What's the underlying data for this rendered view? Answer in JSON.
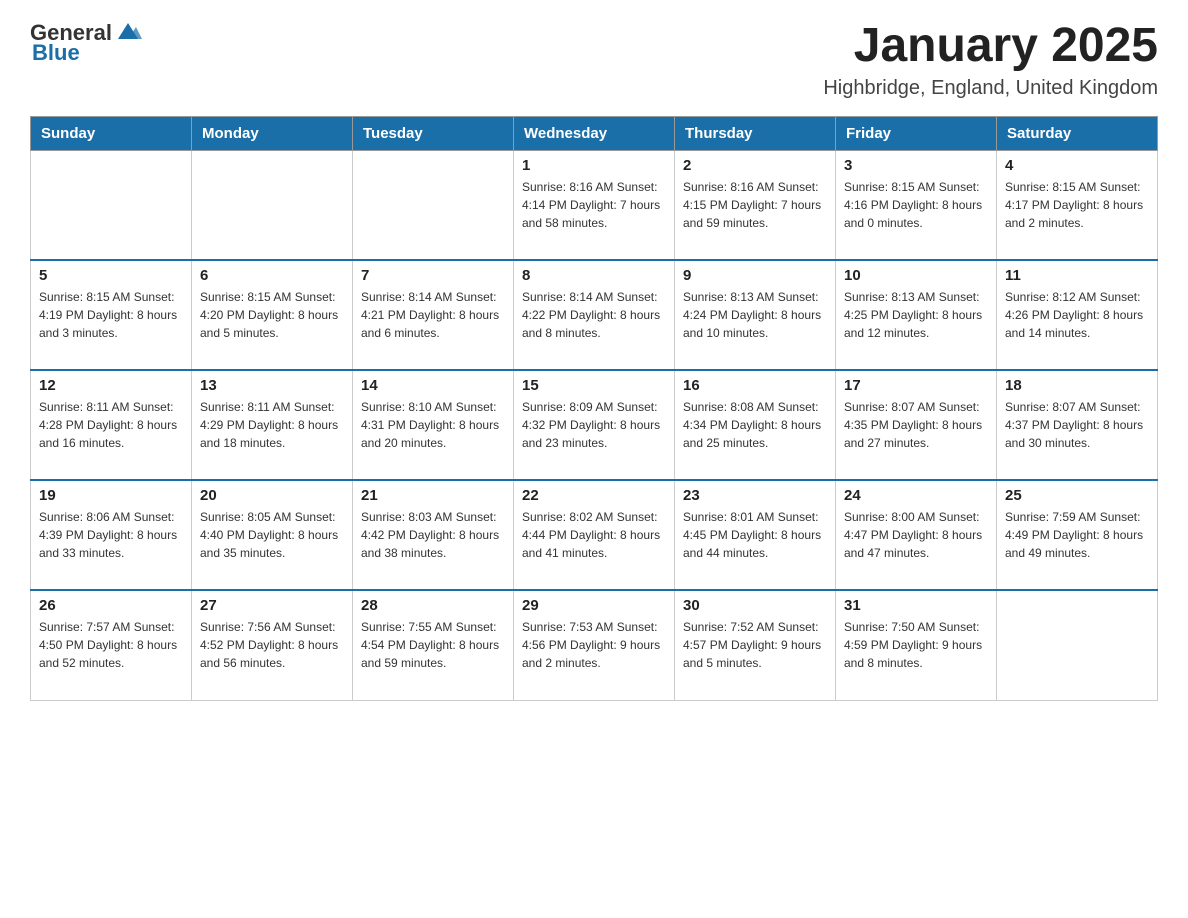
{
  "header": {
    "logo_general": "General",
    "logo_blue": "Blue",
    "month_title": "January 2025",
    "location": "Highbridge, England, United Kingdom"
  },
  "days_of_week": [
    "Sunday",
    "Monday",
    "Tuesday",
    "Wednesday",
    "Thursday",
    "Friday",
    "Saturday"
  ],
  "weeks": [
    [
      {
        "day": "",
        "info": ""
      },
      {
        "day": "",
        "info": ""
      },
      {
        "day": "",
        "info": ""
      },
      {
        "day": "1",
        "info": "Sunrise: 8:16 AM\nSunset: 4:14 PM\nDaylight: 7 hours\nand 58 minutes."
      },
      {
        "day": "2",
        "info": "Sunrise: 8:16 AM\nSunset: 4:15 PM\nDaylight: 7 hours\nand 59 minutes."
      },
      {
        "day": "3",
        "info": "Sunrise: 8:15 AM\nSunset: 4:16 PM\nDaylight: 8 hours\nand 0 minutes."
      },
      {
        "day": "4",
        "info": "Sunrise: 8:15 AM\nSunset: 4:17 PM\nDaylight: 8 hours\nand 2 minutes."
      }
    ],
    [
      {
        "day": "5",
        "info": "Sunrise: 8:15 AM\nSunset: 4:19 PM\nDaylight: 8 hours\nand 3 minutes."
      },
      {
        "day": "6",
        "info": "Sunrise: 8:15 AM\nSunset: 4:20 PM\nDaylight: 8 hours\nand 5 minutes."
      },
      {
        "day": "7",
        "info": "Sunrise: 8:14 AM\nSunset: 4:21 PM\nDaylight: 8 hours\nand 6 minutes."
      },
      {
        "day": "8",
        "info": "Sunrise: 8:14 AM\nSunset: 4:22 PM\nDaylight: 8 hours\nand 8 minutes."
      },
      {
        "day": "9",
        "info": "Sunrise: 8:13 AM\nSunset: 4:24 PM\nDaylight: 8 hours\nand 10 minutes."
      },
      {
        "day": "10",
        "info": "Sunrise: 8:13 AM\nSunset: 4:25 PM\nDaylight: 8 hours\nand 12 minutes."
      },
      {
        "day": "11",
        "info": "Sunrise: 8:12 AM\nSunset: 4:26 PM\nDaylight: 8 hours\nand 14 minutes."
      }
    ],
    [
      {
        "day": "12",
        "info": "Sunrise: 8:11 AM\nSunset: 4:28 PM\nDaylight: 8 hours\nand 16 minutes."
      },
      {
        "day": "13",
        "info": "Sunrise: 8:11 AM\nSunset: 4:29 PM\nDaylight: 8 hours\nand 18 minutes."
      },
      {
        "day": "14",
        "info": "Sunrise: 8:10 AM\nSunset: 4:31 PM\nDaylight: 8 hours\nand 20 minutes."
      },
      {
        "day": "15",
        "info": "Sunrise: 8:09 AM\nSunset: 4:32 PM\nDaylight: 8 hours\nand 23 minutes."
      },
      {
        "day": "16",
        "info": "Sunrise: 8:08 AM\nSunset: 4:34 PM\nDaylight: 8 hours\nand 25 minutes."
      },
      {
        "day": "17",
        "info": "Sunrise: 8:07 AM\nSunset: 4:35 PM\nDaylight: 8 hours\nand 27 minutes."
      },
      {
        "day": "18",
        "info": "Sunrise: 8:07 AM\nSunset: 4:37 PM\nDaylight: 8 hours\nand 30 minutes."
      }
    ],
    [
      {
        "day": "19",
        "info": "Sunrise: 8:06 AM\nSunset: 4:39 PM\nDaylight: 8 hours\nand 33 minutes."
      },
      {
        "day": "20",
        "info": "Sunrise: 8:05 AM\nSunset: 4:40 PM\nDaylight: 8 hours\nand 35 minutes."
      },
      {
        "day": "21",
        "info": "Sunrise: 8:03 AM\nSunset: 4:42 PM\nDaylight: 8 hours\nand 38 minutes."
      },
      {
        "day": "22",
        "info": "Sunrise: 8:02 AM\nSunset: 4:44 PM\nDaylight: 8 hours\nand 41 minutes."
      },
      {
        "day": "23",
        "info": "Sunrise: 8:01 AM\nSunset: 4:45 PM\nDaylight: 8 hours\nand 44 minutes."
      },
      {
        "day": "24",
        "info": "Sunrise: 8:00 AM\nSunset: 4:47 PM\nDaylight: 8 hours\nand 47 minutes."
      },
      {
        "day": "25",
        "info": "Sunrise: 7:59 AM\nSunset: 4:49 PM\nDaylight: 8 hours\nand 49 minutes."
      }
    ],
    [
      {
        "day": "26",
        "info": "Sunrise: 7:57 AM\nSunset: 4:50 PM\nDaylight: 8 hours\nand 52 minutes."
      },
      {
        "day": "27",
        "info": "Sunrise: 7:56 AM\nSunset: 4:52 PM\nDaylight: 8 hours\nand 56 minutes."
      },
      {
        "day": "28",
        "info": "Sunrise: 7:55 AM\nSunset: 4:54 PM\nDaylight: 8 hours\nand 59 minutes."
      },
      {
        "day": "29",
        "info": "Sunrise: 7:53 AM\nSunset: 4:56 PM\nDaylight: 9 hours\nand 2 minutes."
      },
      {
        "day": "30",
        "info": "Sunrise: 7:52 AM\nSunset: 4:57 PM\nDaylight: 9 hours\nand 5 minutes."
      },
      {
        "day": "31",
        "info": "Sunrise: 7:50 AM\nSunset: 4:59 PM\nDaylight: 9 hours\nand 8 minutes."
      },
      {
        "day": "",
        "info": ""
      }
    ]
  ]
}
